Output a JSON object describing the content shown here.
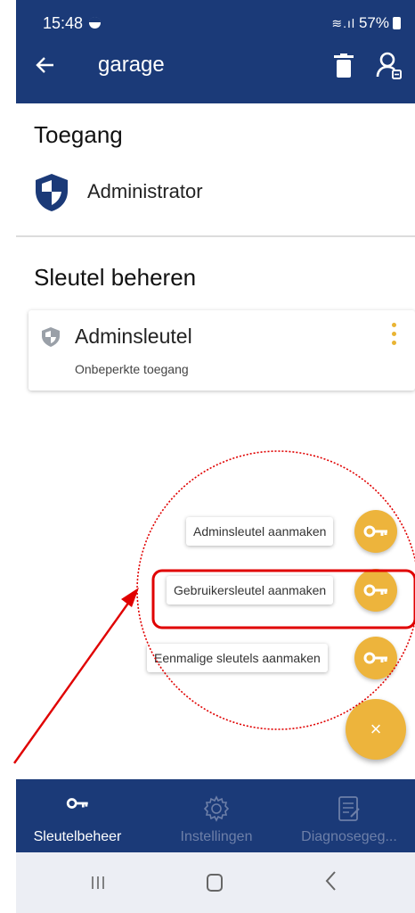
{
  "status": {
    "time": "15:48",
    "signal_icons": "≋.ıl",
    "battery": "57%"
  },
  "toolbar": {
    "title": "garage",
    "back_icon": "arrow-left-icon",
    "delete_icon": "trash-icon",
    "manage_icon": "person-key-icon"
  },
  "access": {
    "heading": "Toegang",
    "role": "Administrator"
  },
  "keys": {
    "heading": "Sleutel beheren",
    "items": [
      {
        "name": "Adminsleutel",
        "description": "Onbeperkte toegang"
      }
    ]
  },
  "speed_dial": {
    "actions": [
      {
        "label": "Adminsleutel aanmaken"
      },
      {
        "label": "Gebruikersleutel aanmaken"
      },
      {
        "label": "Eenmalige sleutels aanmaken"
      }
    ],
    "close_symbol": "×"
  },
  "bottom_nav": {
    "items": [
      {
        "label": "Sleutelbeheer",
        "icon": "key-icon",
        "active": true
      },
      {
        "label": "Instellingen",
        "icon": "gear-icon",
        "active": false
      },
      {
        "label": "Diagnosegeg...",
        "icon": "report-icon",
        "active": false
      }
    ]
  },
  "colors": {
    "primary": "#1b3a78",
    "accent": "#edb43c",
    "annotation": "#e00000"
  }
}
